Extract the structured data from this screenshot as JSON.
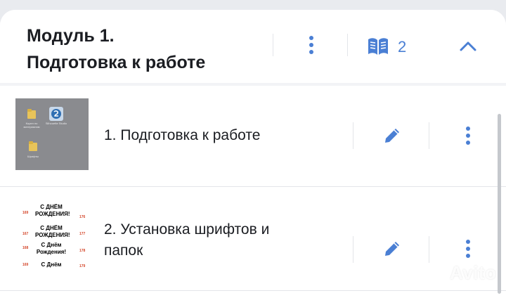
{
  "module": {
    "title_line1": "Модуль 1.",
    "title_line2": "Подготовка к работе",
    "lessons_count": "2"
  },
  "lessons": [
    {
      "title": "1. Подготовка к работе",
      "thumb_icons": [
        "Корел по материалам",
        "Silhouette Studio",
        "Шрифты"
      ]
    },
    {
      "title_line1": "2. Установка шрифтов и",
      "title_line2": "папок",
      "preview_lines": [
        "С ДНЁМ",
        "РОЖДЕНИЯ!",
        "С ДНЁМ",
        "РОЖДЕНИЯ!",
        "С Днём",
        "Рождения!",
        "С Днём"
      ],
      "preview_numbers": [
        "169",
        "176",
        "167",
        "177",
        "168",
        "178",
        "169",
        "179"
      ]
    }
  ],
  "icons": {
    "module_menu": "more-vertical-icon",
    "lessons": "book-icon",
    "collapse": "chevron-up-icon",
    "edit": "pencil-icon",
    "lesson_menu": "more-vertical-icon"
  },
  "colors": {
    "accent": "#4a7fd4",
    "text": "#1b1d22"
  },
  "watermark": "Avito"
}
